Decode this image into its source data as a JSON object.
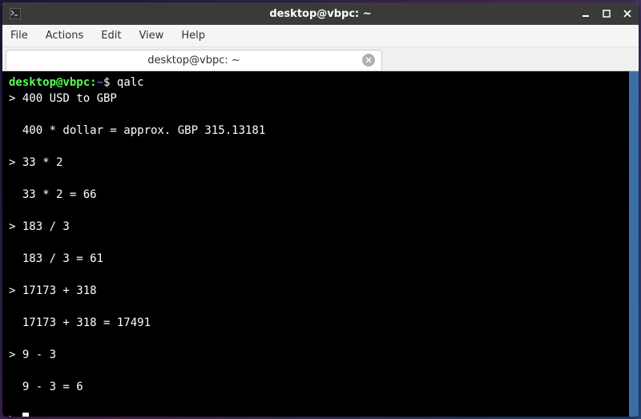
{
  "window": {
    "title": "desktop@vbpc: ~"
  },
  "menubar": {
    "file": "File",
    "actions": "Actions",
    "edit": "Edit",
    "view": "View",
    "help": "Help"
  },
  "tab": {
    "label": "desktop@vbpc: ~"
  },
  "prompt": {
    "user_host": "desktop@vbpc",
    "colon": ":",
    "path": "~",
    "symbol": "$ ",
    "command": "qalc"
  },
  "lines": {
    "l1": "> 400 USD to GBP",
    "l2": "",
    "l3": "  400 * dollar = approx. GBP 315.13181",
    "l4": "",
    "l5": "> 33 * 2",
    "l6": "",
    "l7": "  33 * 2 = 66",
    "l8": "",
    "l9": "> 183 / 3",
    "l10": "",
    "l11": "  183 / 3 = 61",
    "l12": "",
    "l13": "> 17173 + 318",
    "l14": "",
    "l15": "  17173 + 318 = 17491",
    "l16": "",
    "l17": "> 9 - 3",
    "l18": "",
    "l19": "  9 - 3 = 6",
    "l20": "",
    "l21": "> "
  }
}
